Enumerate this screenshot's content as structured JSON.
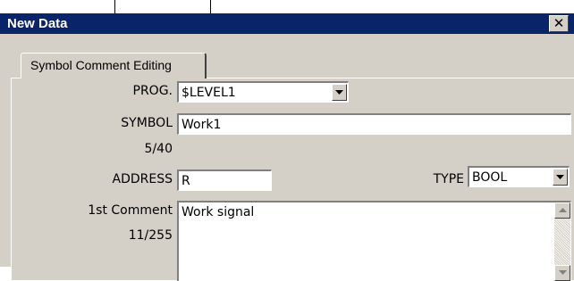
{
  "window": {
    "title": "New Data",
    "close_label": "✕",
    "tab_label": "Symbol Comment Editing"
  },
  "form": {
    "prog": {
      "label": "PROG.",
      "value": "$LEVEL1"
    },
    "symbol": {
      "label": "SYMBOL",
      "value": "Work1",
      "count": "5/40"
    },
    "address": {
      "label": "ADDRESS",
      "value": "R"
    },
    "type": {
      "label": "TYPE",
      "value": "BOOL"
    },
    "comment": {
      "label": "1st Comment",
      "value": "Work signal",
      "count": "11/255"
    }
  },
  "icons": {
    "close": "close-icon",
    "dropdown": "chevron-down-icon",
    "scroll_up": "scroll-up-arrow-icon",
    "scroll_down": "scroll-down-arrow-icon"
  },
  "colors": {
    "titlebar": "#0a246a",
    "face": "#d4d0c8",
    "field": "#ffffff"
  }
}
